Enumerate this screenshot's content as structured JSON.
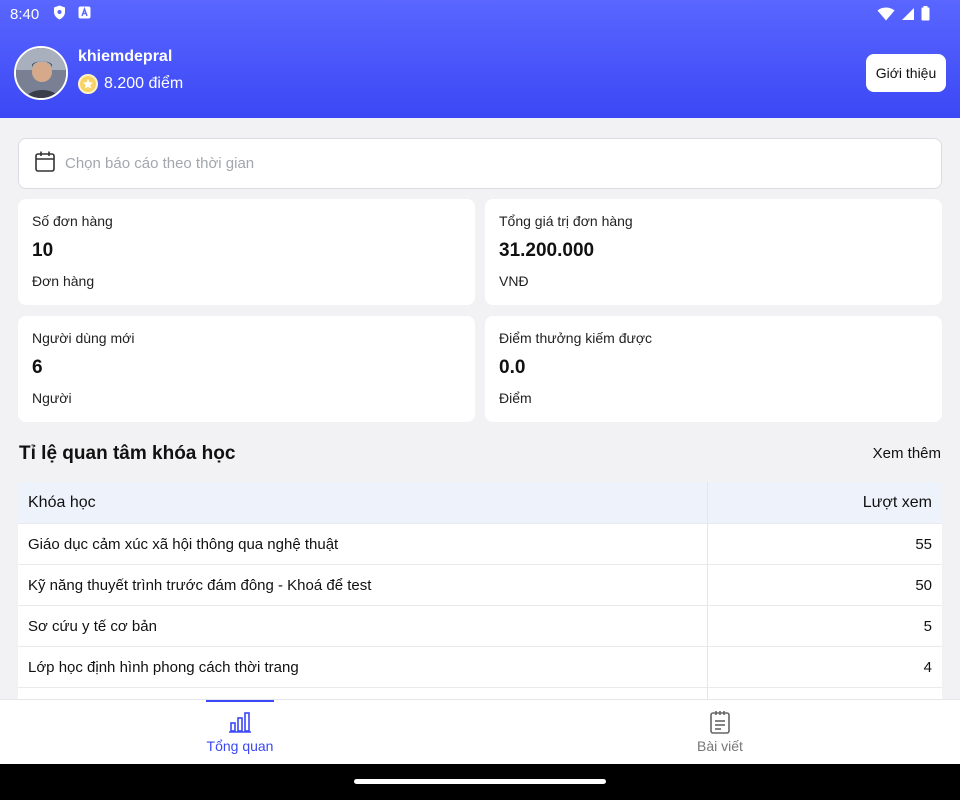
{
  "status_bar": {
    "time": "8:40"
  },
  "user": {
    "name": "khiemdepral",
    "points": "8.200 điểm"
  },
  "header": {
    "intro_button": "Giới thiệu"
  },
  "date_filter": {
    "placeholder": "Chọn báo cáo theo thời gian"
  },
  "stats": [
    {
      "label": "Số đơn hàng",
      "value": "10",
      "unit": "Đơn hàng"
    },
    {
      "label": "Tổng giá trị đơn hàng",
      "value": "31.200.000",
      "unit": "VNĐ"
    },
    {
      "label": "Người dùng mới",
      "value": "6",
      "unit": "Người"
    },
    {
      "label": "Điểm thưởng kiếm được",
      "value": "0.0",
      "unit": "Điểm"
    }
  ],
  "course_interest": {
    "title": "Tỉ lệ quan tâm khóa học",
    "see_more": "Xem thêm",
    "columns": [
      "Khóa học",
      "Lượt xem"
    ],
    "rows": [
      {
        "course": "Giáo dục cảm xúc xã hội thông qua nghệ thuật",
        "views": "55"
      },
      {
        "course": "Kỹ năng thuyết trình trước đám đông - Khoá để test",
        "views": "50"
      },
      {
        "course": "Sơ cứu y tế cơ bản",
        "views": "5"
      },
      {
        "course": "Lớp học định hình phong cách thời trang",
        "views": "4"
      }
    ]
  },
  "bottom_nav": {
    "items": [
      {
        "label": "Tổng quan",
        "icon": "bar-chart-icon",
        "active": true
      },
      {
        "label": "Bài viết",
        "icon": "notepad-icon",
        "active": false
      }
    ]
  },
  "colors": {
    "primary": "#3b48f5",
    "header_top": "#5a66ff",
    "background": "#f2f2f4"
  }
}
